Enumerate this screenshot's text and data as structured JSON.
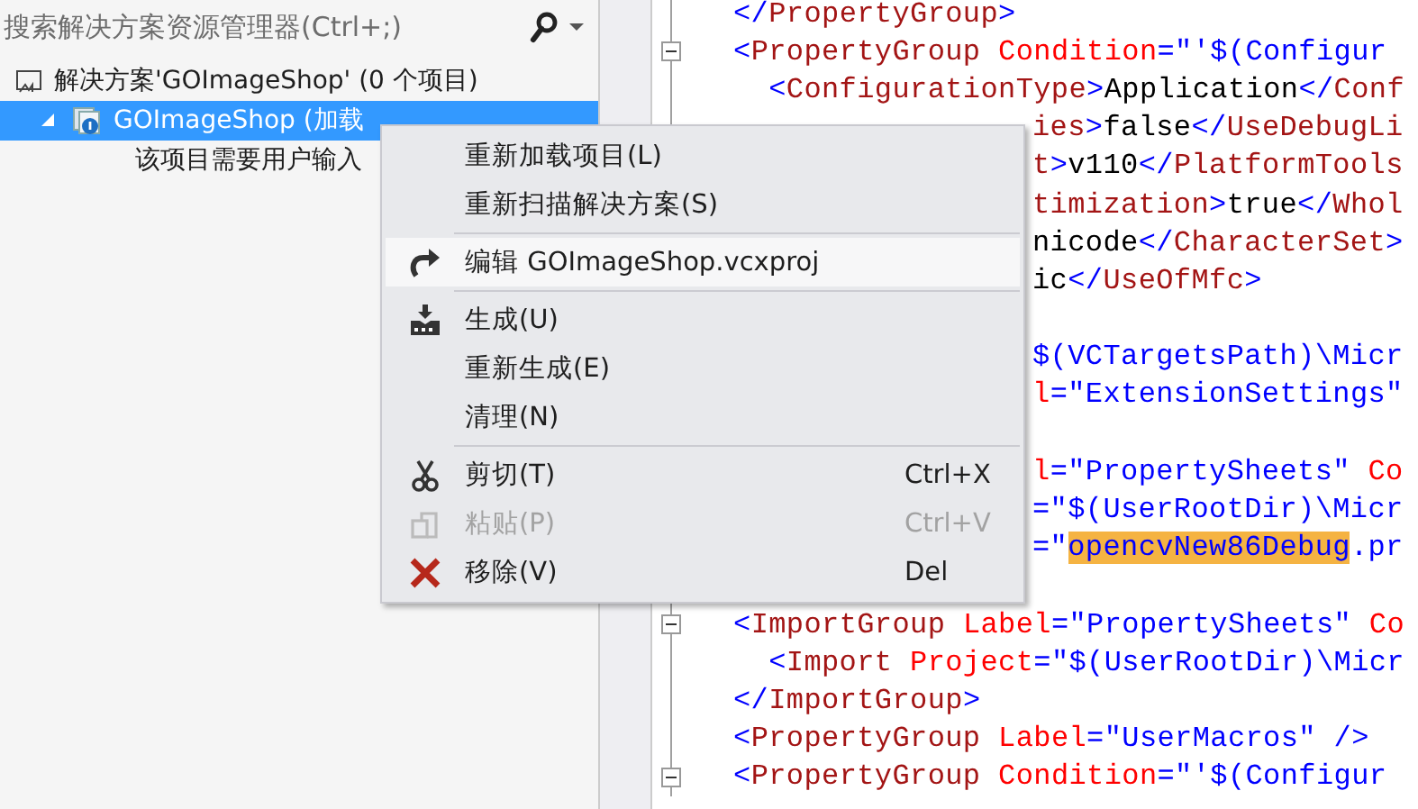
{
  "explorer": {
    "search": {
      "placeholder": "搜索解决方案资源管理器(Ctrl+;)"
    },
    "tree": [
      {
        "label": "解决方案'GOImageShop' (0 个项目)",
        "kind": "solution",
        "selected": false,
        "children": [
          {
            "label": "GOImageShop (加载",
            "kind": "project",
            "selected": true,
            "expanded": true,
            "children": [
              {
                "label": "该项目需要用户输入",
                "kind": "note",
                "selected": false
              }
            ]
          }
        ]
      }
    ]
  },
  "editor": {
    "lines": [
      {
        "kind": "full",
        "fold": false,
        "tokens": [
          {
            "kind": "bracket",
            "text": "</"
          },
          {
            "kind": "tag",
            "text": "PropertyGroup"
          },
          {
            "kind": "bracket",
            "text": ">"
          }
        ]
      },
      {
        "kind": "full",
        "fold": true,
        "tokens": [
          {
            "kind": "bracket",
            "text": "<"
          },
          {
            "kind": "tag",
            "text": "PropertyGroup"
          },
          {
            "kind": "attr",
            "text": " Condition"
          },
          {
            "kind": "value",
            "text": "=\"'$(Configur"
          }
        ]
      },
      {
        "kind": "full",
        "fold": false,
        "tokens": [
          {
            "kind": "bracket",
            "text": "  <"
          },
          {
            "kind": "tag",
            "text": "ConfigurationType"
          },
          {
            "kind": "bracket",
            "text": ">"
          },
          {
            "kind": "text",
            "text": "Application"
          },
          {
            "kind": "bracket",
            "text": "</"
          },
          {
            "kind": "tag",
            "text": "Conf"
          }
        ]
      },
      {
        "kind": "covered",
        "tokens": [
          {
            "kind": "tag",
            "text": "ies"
          },
          {
            "kind": "bracket",
            "text": ">"
          },
          {
            "kind": "text",
            "text": "false"
          },
          {
            "kind": "bracket",
            "text": "</"
          },
          {
            "kind": "tag",
            "text": "UseDebugLi"
          }
        ]
      },
      {
        "kind": "covered",
        "tokens": [
          {
            "kind": "tag",
            "text": "t"
          },
          {
            "kind": "bracket",
            "text": ">"
          },
          {
            "kind": "text",
            "text": "v110"
          },
          {
            "kind": "bracket",
            "text": "</"
          },
          {
            "kind": "tag",
            "text": "PlatformTools"
          }
        ]
      },
      {
        "kind": "covered",
        "tokens": [
          {
            "kind": "tag",
            "text": "timization"
          },
          {
            "kind": "bracket",
            "text": ">"
          },
          {
            "kind": "text",
            "text": "true"
          },
          {
            "kind": "bracket",
            "text": "</"
          },
          {
            "kind": "tag",
            "text": "Whol"
          }
        ]
      },
      {
        "kind": "covered",
        "tokens": [
          {
            "kind": "text",
            "text": "nicode"
          },
          {
            "kind": "bracket",
            "text": "</"
          },
          {
            "kind": "tag",
            "text": "CharacterSet"
          },
          {
            "kind": "bracket",
            "text": ">"
          }
        ]
      },
      {
        "kind": "covered",
        "tokens": [
          {
            "kind": "text",
            "text": "ic"
          },
          {
            "kind": "bracket",
            "text": "</"
          },
          {
            "kind": "tag",
            "text": "UseOfMfc"
          },
          {
            "kind": "bracket",
            "text": ">"
          }
        ]
      },
      {
        "kind": "hidden"
      },
      {
        "kind": "covered",
        "tokens": [
          {
            "kind": "value",
            "text": "$(VCTargetsPath)\\Micr"
          }
        ]
      },
      {
        "kind": "covered",
        "tokens": [
          {
            "kind": "attr",
            "text": "l"
          },
          {
            "kind": "value",
            "text": "=\"ExtensionSettings\""
          }
        ]
      },
      {
        "kind": "hidden"
      },
      {
        "kind": "covered",
        "tokens": [
          {
            "kind": "attr",
            "text": "l"
          },
          {
            "kind": "value",
            "text": "=\"PropertySheets\""
          },
          {
            "kind": "attr",
            "text": " Co"
          }
        ]
      },
      {
        "kind": "covered",
        "tokens": [
          {
            "kind": "value",
            "text": "=\"$(UserRootDir)\\Micr"
          }
        ]
      },
      {
        "kind": "covered",
        "tokens": [
          {
            "kind": "value",
            "text": "=\""
          },
          {
            "kind": "highlight",
            "text": "opencvNew86Debug"
          },
          {
            "kind": "value",
            "text": ".pr"
          }
        ]
      },
      {
        "kind": "hidden"
      },
      {
        "kind": "full",
        "fold": true,
        "tokens": [
          {
            "kind": "bracket",
            "text": "<"
          },
          {
            "kind": "tag",
            "text": "ImportGroup"
          },
          {
            "kind": "attr",
            "text": " Label"
          },
          {
            "kind": "value",
            "text": "=\"PropertySheets\""
          },
          {
            "kind": "attr",
            "text": " Co"
          }
        ]
      },
      {
        "kind": "full",
        "fold": false,
        "tokens": [
          {
            "kind": "bracket",
            "text": "  <"
          },
          {
            "kind": "tag",
            "text": "Import"
          },
          {
            "kind": "attr",
            "text": " Project"
          },
          {
            "kind": "value",
            "text": "=\"$(UserRootDir)\\Micr"
          }
        ]
      },
      {
        "kind": "full",
        "fold": false,
        "tokens": [
          {
            "kind": "bracket",
            "text": "</"
          },
          {
            "kind": "tag",
            "text": "ImportGroup"
          },
          {
            "kind": "bracket",
            "text": ">"
          }
        ]
      },
      {
        "kind": "full",
        "fold": false,
        "tokens": [
          {
            "kind": "bracket",
            "text": "<"
          },
          {
            "kind": "tag",
            "text": "PropertyGroup"
          },
          {
            "kind": "attr",
            "text": " Label"
          },
          {
            "kind": "value",
            "text": "=\"UserMacros\""
          },
          {
            "kind": "bracket",
            "text": " />"
          }
        ]
      },
      {
        "kind": "full",
        "fold": true,
        "tokens": [
          {
            "kind": "bracket",
            "text": "<"
          },
          {
            "kind": "tag",
            "text": "PropertyGroup"
          },
          {
            "kind": "attr",
            "text": " Condition"
          },
          {
            "kind": "value",
            "text": "=\"'$(Configur"
          }
        ]
      }
    ]
  },
  "context_menu": [
    {
      "kind": "plain",
      "label": "重新加载项目(L)",
      "disabled": false,
      "selected": false
    },
    {
      "kind": "plain",
      "label": "重新扫描解决方案(S)",
      "disabled": false,
      "selected": false
    },
    {
      "kind": "separator"
    },
    {
      "kind": "redo",
      "label": "编辑 GOImageShop.vcxproj",
      "disabled": false,
      "selected": true
    },
    {
      "kind": "separator"
    },
    {
      "kind": "build",
      "label": "生成(U)",
      "disabled": false,
      "selected": false
    },
    {
      "kind": "plain",
      "label": "重新生成(E)",
      "disabled": false,
      "selected": false
    },
    {
      "kind": "plain",
      "label": "清理(N)",
      "disabled": false,
      "selected": false
    },
    {
      "kind": "separator"
    },
    {
      "kind": "cut",
      "label": "剪切(T)",
      "shortcut": "Ctrl+X",
      "disabled": false,
      "selected": false
    },
    {
      "kind": "paste",
      "label": "粘贴(P)",
      "shortcut": "Ctrl+V",
      "disabled": true,
      "selected": false
    },
    {
      "kind": "remove",
      "label": "移除(V)",
      "shortcut": "Del",
      "disabled": false,
      "selected": false
    }
  ]
}
